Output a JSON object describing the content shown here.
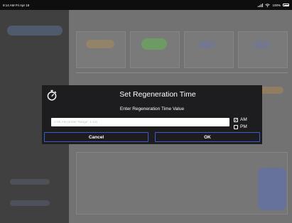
{
  "status_bar": {
    "time_date": "9:14 AM  Fri Apr 18",
    "battery": "100%"
  },
  "dialog": {
    "icon": "stopwatch-icon",
    "title": "Set Regeneration Time",
    "subtitle": "Enter Regeneration Time Value",
    "input": {
      "value": "",
      "placeholder": "2:00 AM (Enter Range: 1-12)"
    },
    "ampm": {
      "am_label": "AM",
      "am_checked": true,
      "pm_label": "PM",
      "pm_checked": false
    },
    "buttons": {
      "cancel": "Cancel",
      "ok": "OK"
    }
  },
  "colors": {
    "dialog_bg": "#1d1d1f",
    "button_border": "#3d5cc8",
    "overlay": "#6d6d6d"
  }
}
